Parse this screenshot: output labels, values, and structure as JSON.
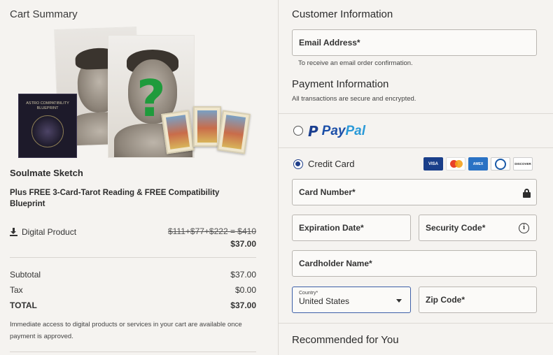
{
  "cart": {
    "title": "Cart Summary",
    "book_text": "ASTRO COMPATIBILITY BLUEPRINT",
    "product_name": "Soulmate Sketch",
    "product_desc": "Plus FREE 3-Card-Tarot Reading & FREE Compatibility Blueprint",
    "digital_label": "Digital Product",
    "strike_price": "$111+$77+$222 = $410",
    "price": "$37.00",
    "subtotal_label": "Subtotal",
    "subtotal_value": "$37.00",
    "tax_label": "Tax",
    "tax_value": "$0.00",
    "total_label": "TOTAL",
    "total_value": "$37.00",
    "note": "Immediate access to digital products or services in your cart are available once payment is approved."
  },
  "customer": {
    "title": "Customer Information",
    "email_label": "Email Address*",
    "email_hint": "To receive an email order confirmation."
  },
  "payment": {
    "title": "Payment Information",
    "subtitle": "All transactions are secure and encrypted.",
    "paypal_pay": "Pay",
    "paypal_pal": "Pal",
    "paypal_selected": false,
    "credit_label": "Credit Card",
    "credit_selected": true,
    "card_brands": [
      "visa-icon",
      "mastercard-icon",
      "amex-icon",
      "diners-icon",
      "discover-icon"
    ],
    "visa_text": "VISA",
    "amex_text": "AMEX",
    "discover_text": "DISCOVER",
    "card_number_label": "Card Number*",
    "expiration_label": "Expiration Date*",
    "security_label": "Security Code*",
    "info_glyph": "i",
    "cardholder_label": "Cardholder Name*",
    "country_label": "Country*",
    "country_value": "United States",
    "zip_label": "Zip Code*"
  },
  "recommended": {
    "title": "Recommended for You"
  }
}
